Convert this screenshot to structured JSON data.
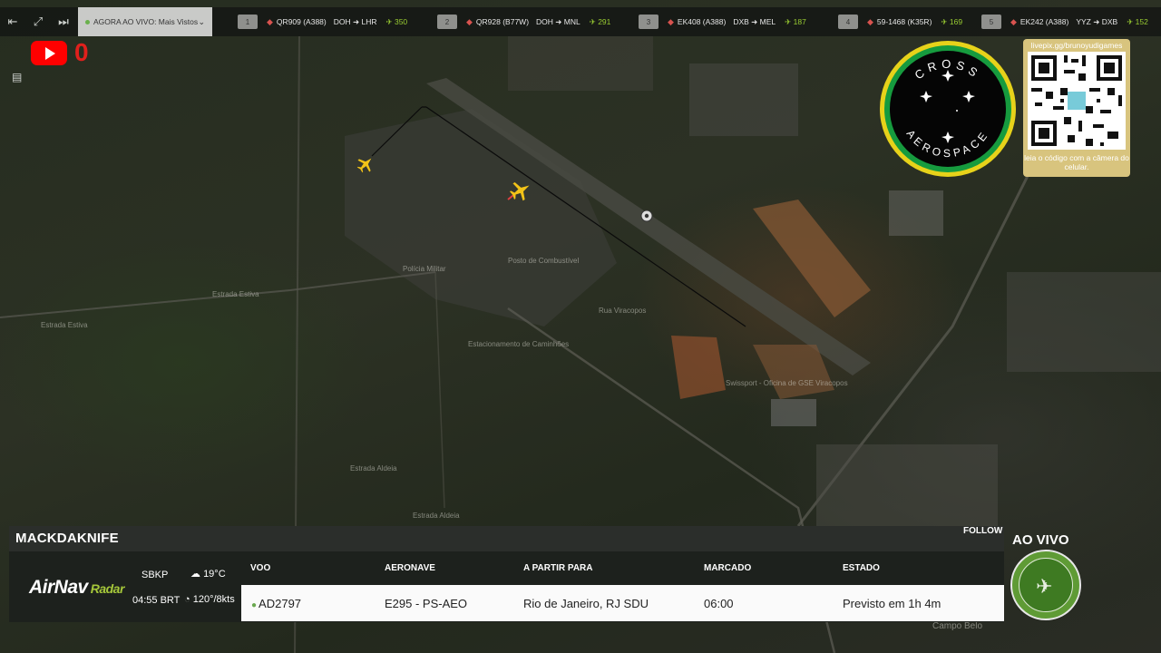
{
  "topbar": {
    "live_label": "AGORA AO VIVO: Mais Vistos",
    "flights": [
      {
        "index": "1",
        "flight": "QR909 (A388)",
        "route": "DOH ➜ LHR",
        "speed": "350"
      },
      {
        "index": "2",
        "flight": "QR928 (B77W)",
        "route": "DOH ➜ MNL",
        "speed": "291"
      },
      {
        "index": "3",
        "flight": "EK408 (A388)",
        "route": "DXB ➜ MEL",
        "speed": "187"
      },
      {
        "index": "4",
        "flight": "59-1468 (K35R)",
        "route": "",
        "speed": "169"
      },
      {
        "index": "5",
        "flight": "EK242 (A388)",
        "route": "YYZ ➜ DXB",
        "speed": "152"
      }
    ]
  },
  "youtube": {
    "count": "0"
  },
  "badge": {
    "top_text": "CROSS",
    "bottom_text": "AEROSPACE"
  },
  "qr": {
    "url": "livepix.gg/brunoyudigames",
    "caption": "leia o código com a câmera do celular."
  },
  "map_labels": {
    "policia": "Polícia Militar",
    "posto": "Posto de Combustível",
    "estacionamento": "Estacionamento de Caminhões",
    "swissport": "Swissport - Oficina de GSE Viracopos",
    "estrada_1": "Estrada Estiva",
    "estrada_2": "Estrada Estiva",
    "rua": "Rua Viracopos",
    "estrada_3": "Estrada Aldeia",
    "estrada_4": "Estrada Aldeia",
    "campo_belo": "Campo Belo"
  },
  "panel": {
    "title": "MACKDAKNIFE",
    "follow": "FOLLOW",
    "brand": "AirNav",
    "brand_suffix": "Radar",
    "airport_code": "SBKP",
    "local_time": "04:55 BRT",
    "temperature": "19°C",
    "wind": "120°/8kts",
    "columns": {
      "flight": "VOO",
      "aircraft": "AERONAVE",
      "route": "A PARTIR PARA",
      "scheduled": "MARCADO",
      "status": "ESTADO"
    },
    "row": {
      "flight": "AD2797",
      "aircraft": "E295 - PS-AEO",
      "route": "Rio de Janeiro, RJ SDU",
      "scheduled": "06:00",
      "status": "Previsto em 1h 4m"
    }
  },
  "ao_vivo": "AO VIVO",
  "colors": {
    "accent_green": "#a6c83a",
    "youtube_red": "#ff0000",
    "badge_yellow": "#e7d21a",
    "badge_green": "#169b3e"
  }
}
